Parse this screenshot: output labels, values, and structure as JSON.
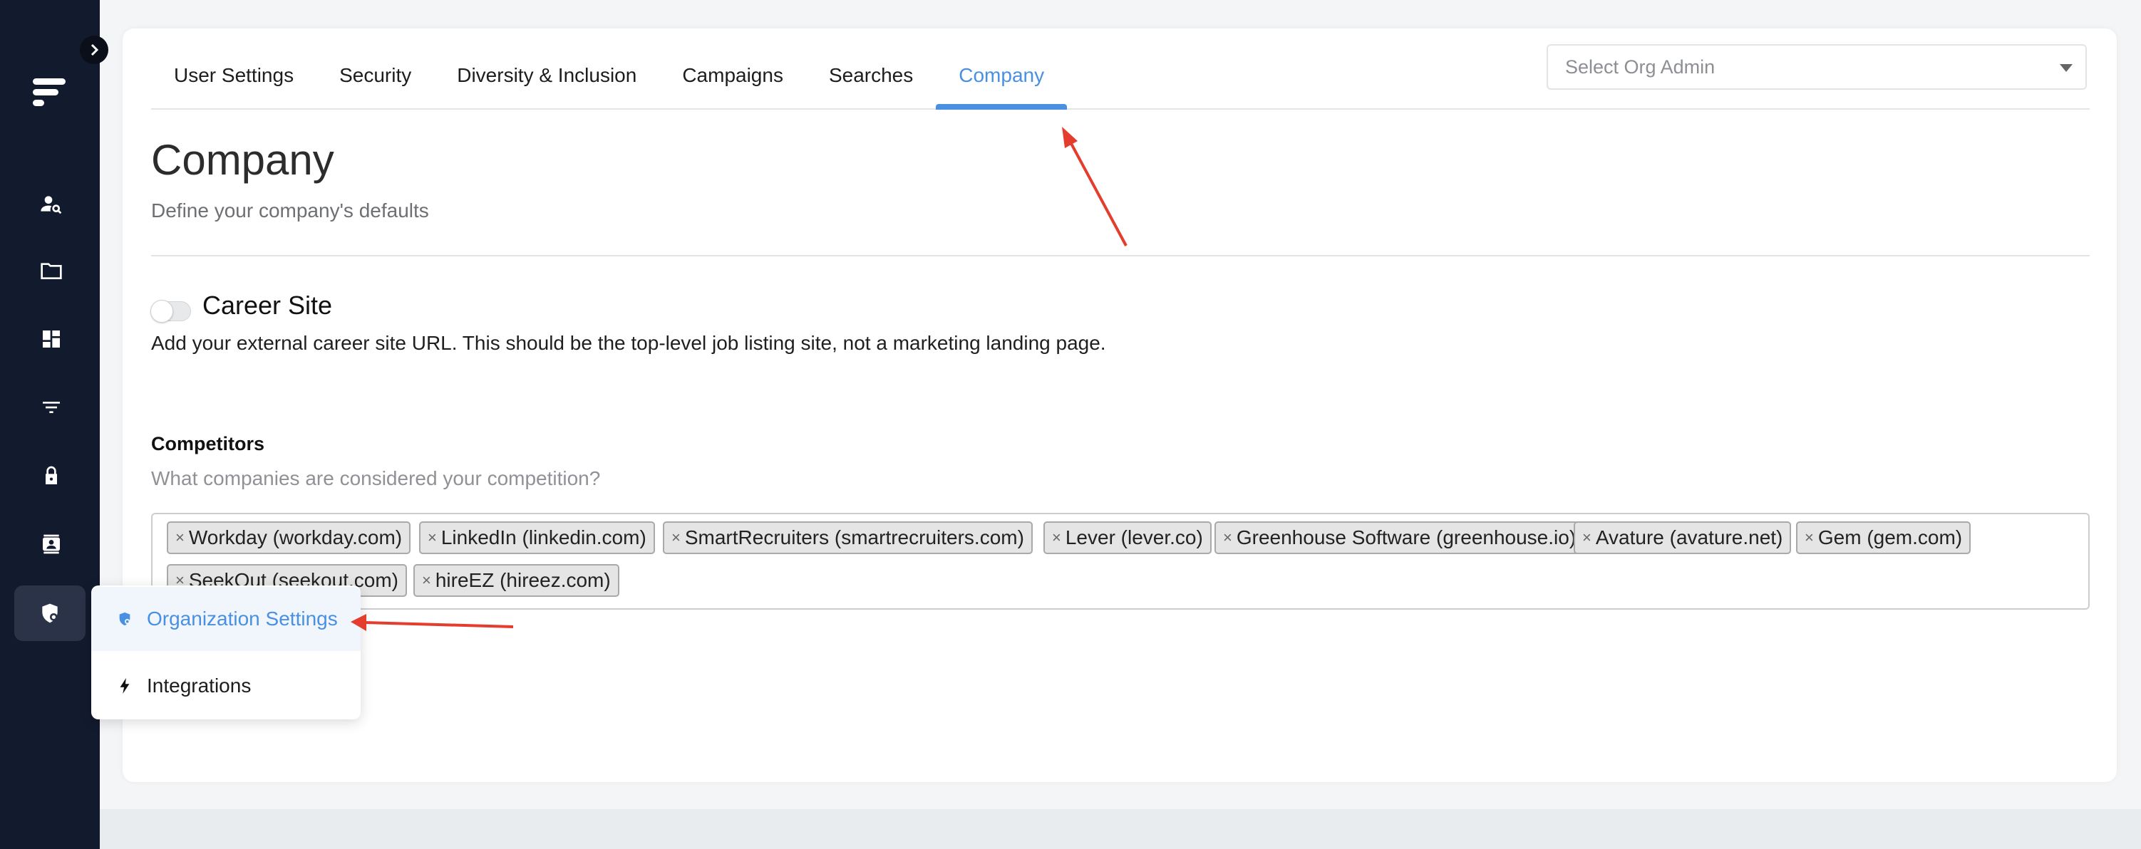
{
  "tabs": [
    {
      "label": "User Settings"
    },
    {
      "label": "Security"
    },
    {
      "label": "Diversity & Inclusion"
    },
    {
      "label": "Campaigns"
    },
    {
      "label": "Searches"
    },
    {
      "label": "Company"
    }
  ],
  "active_tab": "Company",
  "org_admin_select": {
    "placeholder": "Select Org Admin"
  },
  "page": {
    "title": "Company",
    "subtitle": "Define your company's defaults"
  },
  "career_site": {
    "title": "Career Site",
    "description": "Add your external career site URL. This should be the top-level job listing site, not a marketing landing page.",
    "enabled": false
  },
  "competitors": {
    "label": "Competitors",
    "help": "What companies are considered your competition?",
    "remove_glyph": "×",
    "tags": [
      "Workday (workday.com)",
      "LinkedIn (linkedin.com)",
      "SmartRecruiters (smartrecruiters.com)",
      "Lever (lever.co)",
      "Greenhouse Software (greenhouse.io)",
      "Avature (avature.net)",
      "Gem (gem.com)",
      "SeekOut (seekout.com)",
      "hireEZ (hireez.com)"
    ]
  },
  "settings_menu": {
    "items": [
      {
        "label": "Organization Settings",
        "icon": "shield-gear-icon"
      },
      {
        "label": "Integrations",
        "icon": "lightning-icon"
      }
    ]
  },
  "sidebar": {
    "icons": [
      "person-search-icon",
      "folder-icon",
      "dashboard-icon",
      "filter-icon",
      "lock-icon",
      "contact-card-icon",
      "shield-gear-icon"
    ]
  },
  "colors": {
    "sidebar_bg": "#121a2d",
    "accent": "#4a90e2",
    "annotation_arrow": "#e43d2d"
  }
}
